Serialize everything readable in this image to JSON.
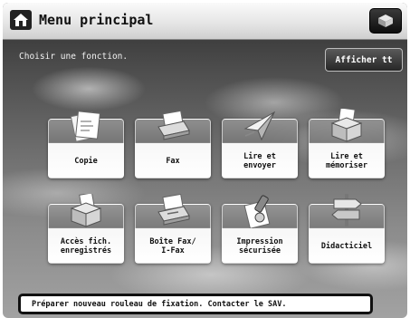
{
  "header": {
    "title": "Menu principal"
  },
  "prompt": "Choisir une fonction.",
  "show_all_label": "Afficher tt",
  "functions": [
    {
      "label": "Copie",
      "icon": "copy-icon"
    },
    {
      "label": "Fax",
      "icon": "fax-icon"
    },
    {
      "label": "Lire et\nenvoyer",
      "icon": "scan-send-icon"
    },
    {
      "label": "Lire et\nmémoriser",
      "icon": "scan-store-icon"
    },
    {
      "label": "Accès fich.\nenregistrés",
      "icon": "stored-files-icon"
    },
    {
      "label": "Boîte Fax/\nI-Fax",
      "icon": "fax-inbox-icon"
    },
    {
      "label": "Impression\nsécurisée",
      "icon": "secure-print-icon"
    },
    {
      "label": "Didacticiel",
      "icon": "tutorial-icon"
    }
  ],
  "status_message": "Préparer nouveau rouleau de fixation. Contacter le SAV."
}
